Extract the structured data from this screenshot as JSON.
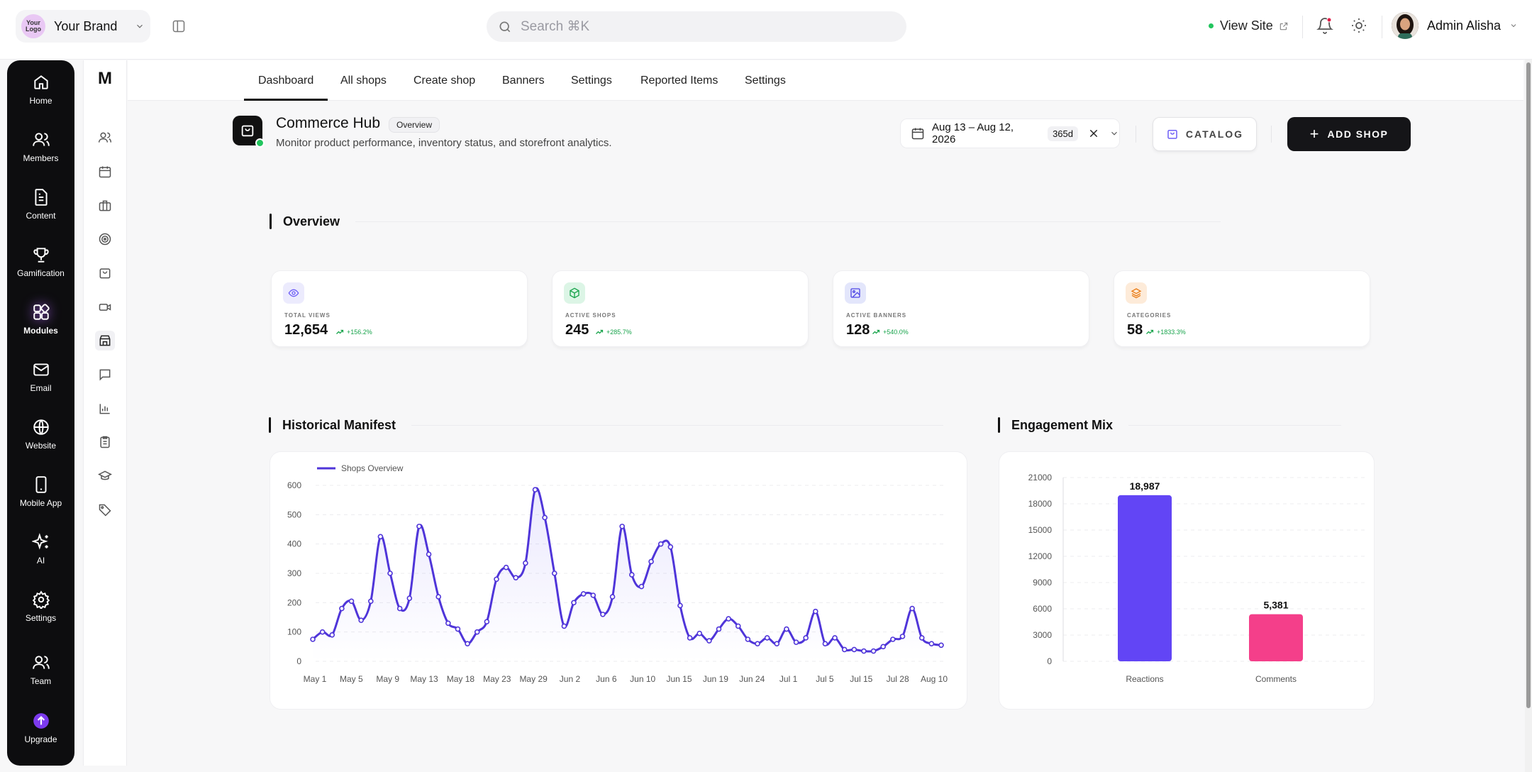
{
  "brand": {
    "logo_text": "Your Logo",
    "name": "Your Brand"
  },
  "search": {
    "placeholder": "Search ⌘K"
  },
  "header": {
    "view_site": "View Site",
    "user_name": "Admin Alisha"
  },
  "rail": {
    "items": [
      {
        "label": "Home",
        "icon": "home-icon"
      },
      {
        "label": "Members",
        "icon": "members-icon"
      },
      {
        "label": "Content",
        "icon": "document-icon"
      },
      {
        "label": "Gamification",
        "icon": "trophy-icon"
      },
      {
        "label": "Modules",
        "icon": "modules-icon",
        "active": true
      },
      {
        "label": "Email",
        "icon": "mail-icon"
      },
      {
        "label": "Website",
        "icon": "globe-icon"
      },
      {
        "label": "Mobile App",
        "icon": "phone-icon"
      },
      {
        "label": "AI",
        "icon": "sparkles-icon"
      },
      {
        "label": "Settings",
        "icon": "gear-icon"
      },
      {
        "label": "Team",
        "icon": "team-icon"
      },
      {
        "label": "Upgrade",
        "icon": "upgrade-icon"
      }
    ]
  },
  "iconbar": {
    "logo": "M"
  },
  "tabs": [
    "Dashboard",
    "All shops",
    "Create shop",
    "Banners",
    "Settings",
    "Reported Items",
    "Settings"
  ],
  "page": {
    "title": "Commerce Hub",
    "badge": "Overview",
    "subtitle": "Monitor product performance, inventory status, and storefront analytics.",
    "date_range": "Aug 13 – Aug 12, 2026",
    "date_days": "365d",
    "catalog_label": "CATALOG",
    "add_shop_label": "ADD SHOP"
  },
  "overview": {
    "title": "Overview",
    "kpis": [
      {
        "label": "TOTAL VIEWS",
        "value": "12,654",
        "change": "+156.2%",
        "icon": "eye-icon",
        "color": "#6d5ef6",
        "bg": "#ecebfd"
      },
      {
        "label": "ACTIVE SHOPS",
        "value": "245",
        "change": "+285.7%",
        "icon": "cube-icon",
        "color": "#16a34a",
        "bg": "#dcf5e6"
      },
      {
        "label": "ACTIVE BANNERS",
        "value": "128",
        "change": "+540.0%",
        "icon": "image-icon",
        "color": "#4f46e5",
        "bg": "#e3e6fb"
      },
      {
        "label": "CATEGORIES",
        "value": "58",
        "change": "+1833.3%",
        "icon": "layers-icon",
        "color": "#ea7a12",
        "bg": "#fdebd9"
      }
    ]
  },
  "historical": {
    "title": "Historical Manifest"
  },
  "engagement": {
    "title": "Engagement Mix"
  },
  "chart_data": [
    {
      "type": "line",
      "title": "Historical Manifest",
      "series": [
        {
          "name": "Shops Overview",
          "color": "#4f35d9",
          "values": [
            75,
            100,
            90,
            180,
            205,
            140,
            205,
            425,
            300,
            180,
            215,
            460,
            365,
            220,
            130,
            110,
            60,
            100,
            135,
            280,
            320,
            285,
            335,
            585,
            490,
            300,
            120,
            200,
            230,
            225,
            160,
            220,
            460,
            295,
            255,
            340,
            400,
            390,
            190,
            80,
            95,
            70,
            110,
            145,
            120,
            75,
            60,
            80,
            60,
            110,
            65,
            80,
            170,
            60,
            80,
            40,
            40,
            35,
            35,
            50,
            75,
            85,
            180,
            80,
            60,
            55
          ]
        }
      ],
      "x_labels": [
        "May 1",
        "May 5",
        "May 9",
        "May 13",
        "May 18",
        "May 23",
        "May 29",
        "Jun 2",
        "Jun 6",
        "Jun 10",
        "Jun 15",
        "Jun 19",
        "Jun 24",
        "Jul 1",
        "Jul 5",
        "Jul 15",
        "Jul 28",
        "Aug 10"
      ],
      "y_ticks": [
        0,
        100,
        200,
        300,
        400,
        500,
        600
      ],
      "ylim": [
        0,
        600
      ],
      "grid": true,
      "legend": "top-left"
    },
    {
      "type": "bar",
      "title": "Engagement Mix",
      "categories": [
        "Reactions",
        "Comments"
      ],
      "values": [
        18987,
        5381
      ],
      "value_labels": [
        "18,987",
        "5,381"
      ],
      "colors": [
        "#6245f5",
        "#f43f8a"
      ],
      "y_ticks": [
        0,
        3000,
        6000,
        9000,
        12000,
        15000,
        18000,
        21000
      ],
      "ylim": [
        0,
        21000
      ],
      "grid": true
    }
  ]
}
